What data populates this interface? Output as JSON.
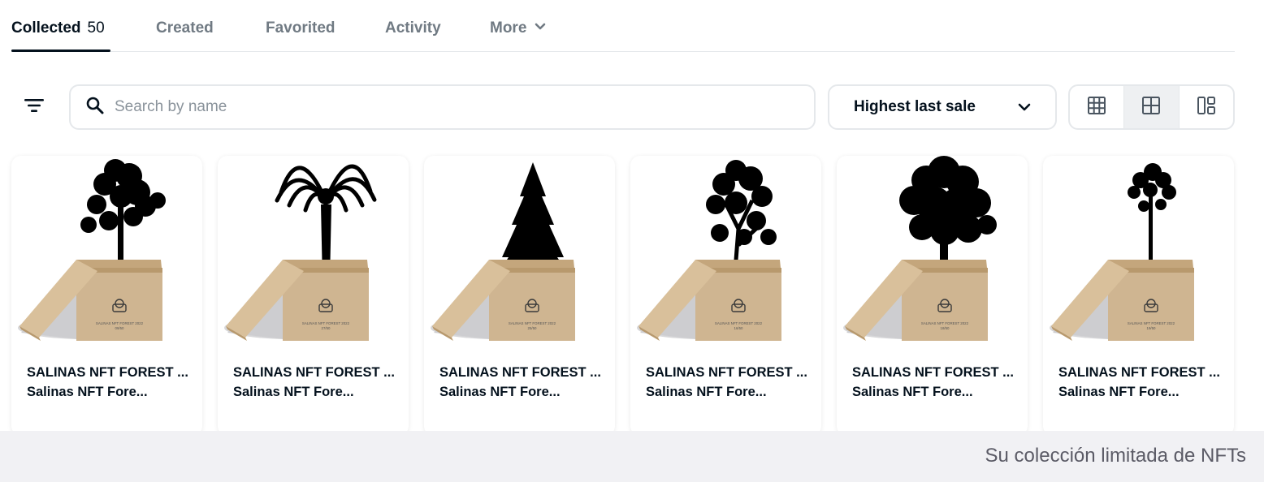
{
  "tabs": [
    {
      "label": "Collected",
      "count": "50",
      "active": true
    },
    {
      "label": "Created"
    },
    {
      "label": "Favorited"
    },
    {
      "label": "Activity"
    },
    {
      "label": "More"
    }
  ],
  "search": {
    "placeholder": "Search by name",
    "icon": "search-icon"
  },
  "sort": {
    "selected": "Highest last sale",
    "icon": "chevron-down-icon"
  },
  "view_options": [
    {
      "icon": "grid-small-icon",
      "active": false
    },
    {
      "icon": "grid-large-icon",
      "active": true
    },
    {
      "icon": "grid-masonry-icon",
      "active": false
    }
  ],
  "items": [
    {
      "title": "SALINAS NFT FOREST ...",
      "collection": "Salinas NFT Fore...",
      "box_label": "SALINAS NFT FOREST 2022",
      "box_number": "09/50",
      "tree": "broadleaf"
    },
    {
      "title": "SALINAS NFT FOREST ...",
      "collection": "Salinas NFT Fore...",
      "box_label": "SALINAS NFT FOREST 2022",
      "box_number": "27/50",
      "tree": "palm"
    },
    {
      "title": "SALINAS NFT FOREST ...",
      "collection": "Salinas NFT Fore...",
      "box_label": "SALINAS NFT FOREST 2022",
      "box_number": "25/50",
      "tree": "fir"
    },
    {
      "title": "SALINAS NFT FOREST ...",
      "collection": "Salinas NFT Fore...",
      "box_label": "SALINAS NFT FOREST 2022",
      "box_number": "16/50",
      "tree": "birch"
    },
    {
      "title": "SALINAS NFT FOREST ...",
      "collection": "Salinas NFT Fore...",
      "box_label": "SALINAS NFT FOREST 2022",
      "box_number": "18/50",
      "tree": "oak"
    },
    {
      "title": "SALINAS NFT FOREST ...",
      "collection": "Salinas NFT Fore...",
      "box_label": "SALINAS NFT FOREST 2022",
      "box_number": "19/50",
      "tree": "pine"
    }
  ],
  "caption": "Su colección limitada de NFTs",
  "colors": {
    "text": "#04111d",
    "muted": "#707a83",
    "border": "#e5e8eb",
    "box": "#cfb591"
  }
}
